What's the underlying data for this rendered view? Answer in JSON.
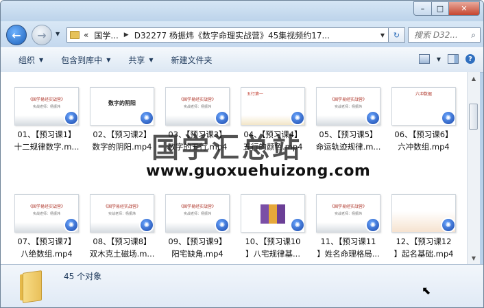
{
  "window": {
    "caption_min": "–",
    "caption_max": "□",
    "caption_close": "✕"
  },
  "address": {
    "back_glyph": "←",
    "fwd_glyph": "→",
    "crumb_root": "«",
    "crumb_1": "国学...",
    "crumb_2": "D32277 杨振炜《数字命理实战营》45集视频约17...",
    "refresh_glyph": "↻"
  },
  "search": {
    "placeholder": "搜索 D32..."
  },
  "toolbar": {
    "organize": "组织",
    "include_library": "包含到库中",
    "share": "共享",
    "new_folder": "新建文件夹"
  },
  "thumb_text": {
    "course_title": "《国学易经实战营》",
    "course_sub": "实战老师：杨振炜",
    "yin_yang": "数字的阴阳",
    "five_elements": "五行第一",
    "liuchong": "六冲数据"
  },
  "files": [
    {
      "line1": "01、【预习课1】",
      "line2": "十二规律数字.m..."
    },
    {
      "line1": "02、【预习课2】",
      "line2": "数字的阴阳.mp4"
    },
    {
      "line1": "03、【预习课3】",
      "line2": "数字的五行.mp4"
    },
    {
      "line1": "04、【预习课4】",
      "line2": "五行的颜色.mp4"
    },
    {
      "line1": "05、【预习课5】",
      "line2": "命运轨迹规律.m..."
    },
    {
      "line1": "06、【预习课6】",
      "line2": "六冲数组.mp4"
    },
    {
      "line1": "07、【预习课7】",
      "line2": "八绝数组.mp4"
    },
    {
      "line1": "08、【预习课8】",
      "line2": "双木克土磁场.m..."
    },
    {
      "line1": "09、【预习课9】",
      "line2": "阳宅缺角.mp4"
    },
    {
      "line1": "10、【预习课10",
      "line2": "】八宅规律基..."
    },
    {
      "line1": "11、【预习课11",
      "line2": "】姓名命理格局..."
    },
    {
      "line1": "12、【预习课12",
      "line2": "】起名基础.mp4"
    }
  ],
  "watermark": {
    "text": "国学汇总站",
    "url": "www.guoxuehuizong.com"
  },
  "details": {
    "count": "45 个对象"
  },
  "icons": {
    "media_badge": "film-reel-icon",
    "folder": "folder-icon"
  },
  "colors": {
    "frame": "#b9d1ea",
    "toolbar_text": "#1e395b",
    "close": "#c5452f"
  }
}
